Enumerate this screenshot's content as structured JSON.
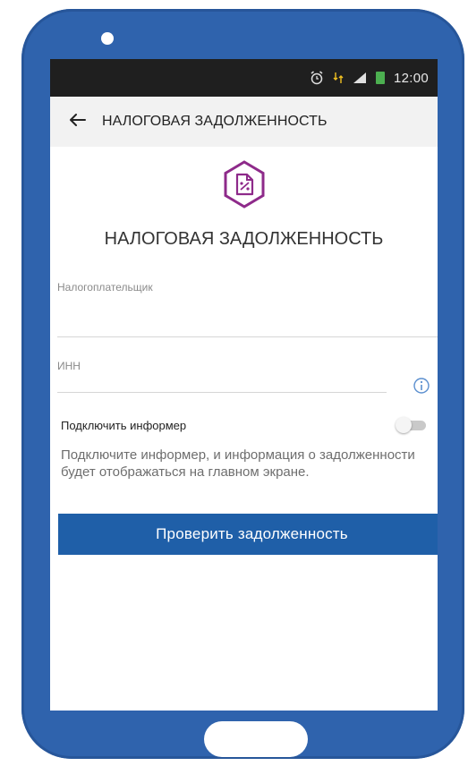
{
  "status_bar": {
    "time": "12:00"
  },
  "toolbar": {
    "title": "НАЛОГОВАЯ ЗАДОЛЖЕННОСТЬ"
  },
  "hero": {
    "title": "НАЛОГОВАЯ ЗАДОЛЖЕННОСТЬ",
    "icon": "tax-document-icon",
    "accent_color": "#8e2a8a"
  },
  "form": {
    "taxpayer_label": "Налогоплательщик",
    "taxpayer_value": "",
    "inn_label": "ИНН",
    "inn_value": ""
  },
  "informer": {
    "label": "Подключить информер",
    "enabled": false,
    "description": "Подключите информер, и информация о задолженности будет отображаться на главном экране."
  },
  "actions": {
    "check_label": "Проверить задолженность",
    "button_color": "#1f5fa8"
  },
  "device": {
    "frame_color": "#2f63ad"
  }
}
